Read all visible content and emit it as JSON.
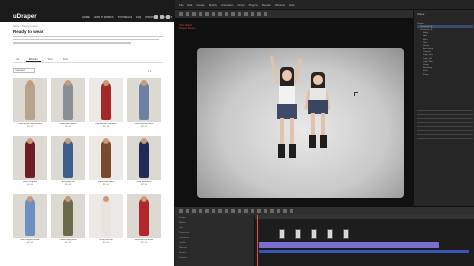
{
  "browser": {
    "logo": "uDraper",
    "nav": [
      "HOME",
      "HOW IT WORKS",
      "TUTORIALS",
      "FAQ",
      "PRICING",
      "CONTACT",
      "ABOUT"
    ],
    "breadcrumb": "Home > Ready to wear",
    "page_title": "Ready to wear",
    "tabs": [
      "All",
      "Women",
      "Men",
      "Kids"
    ],
    "active_tab": "Women",
    "sort_label": "Featured",
    "result_count": "",
    "pager": "1 2",
    "products": [
      {
        "name": "Crop top with long trousers",
        "price": "$15.00",
        "color": "#b6a38e"
      },
      {
        "name": "Silver puffer jacket",
        "price": "$15.00",
        "color": "#8a8f96"
      },
      {
        "name": "Red sweater and jeans",
        "price": "$15.00",
        "color": "#a32828"
      },
      {
        "name": "Floral summer dress",
        "price": "$15.00",
        "color": "#6d7fa5"
      },
      {
        "name": "Wine red gown",
        "price": "$15.00",
        "color": "#6e1d24"
      },
      {
        "name": "Blue yoga set",
        "price": "$15.00",
        "color": "#3d5e8c"
      },
      {
        "name": "Brown satin dress",
        "price": "$15.00",
        "color": "#7a4a2c"
      },
      {
        "name": "Navy midi dress",
        "price": "$15.00",
        "color": "#1f2c5a"
      },
      {
        "name": "Blue cropped hoodie",
        "price": "$15.00",
        "color": "#6a8fc0"
      },
      {
        "name": "Camo cargo pants",
        "price": "$15.00",
        "color": "#6b6a4a"
      },
      {
        "name": "White tank top",
        "price": "$15.00",
        "color": "#e8e3dc"
      },
      {
        "name": "Red satin slip dress",
        "price": "$15.00",
        "color": "#b3262c"
      }
    ]
  },
  "app": {
    "menu": [
      "File",
      "Edit",
      "Create",
      "Modify",
      "Animation",
      "Script",
      "Plugins",
      "Render",
      "Window",
      "Help"
    ],
    "info_lines": [
      "Pick Object",
      "Project Dance"
    ],
    "scene_title": "Scene",
    "tree": [
      "Project",
      "Character_A",
      "Character_B",
      "Body",
      "Hair",
      "Shirt",
      "Skirt",
      "Shoes",
      "Accessory",
      "Camera",
      "Light_Key",
      "Light_Fill",
      "Light_Rim",
      "Stage",
      "Backdrop",
      "Floor",
      "Props"
    ],
    "tracks": [
      "Project",
      "Motion",
      "Clip",
      "Transform",
      "Constraint",
      "Visible",
      "Material",
      "Sound",
      "Camera"
    ]
  },
  "colors": {
    "accent_blue": "#3a55b8",
    "clip_purple": "#7a6fd0",
    "playhead": "#e05050"
  }
}
